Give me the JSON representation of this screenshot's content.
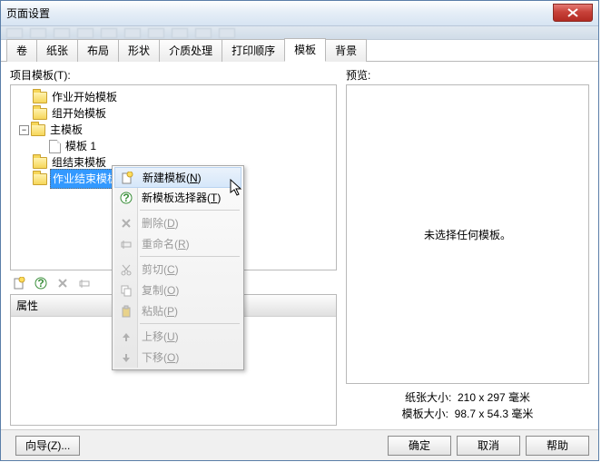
{
  "window": {
    "title": "页面设置"
  },
  "tabs": [
    "卷",
    "纸张",
    "布局",
    "形状",
    "介质处理",
    "打印顺序",
    "模板",
    "背景"
  ],
  "activeTabIndex": 6,
  "leftPane": {
    "label": "项目模板(T):",
    "tree": {
      "nodes": [
        {
          "label": "作业开始模板",
          "type": "folder"
        },
        {
          "label": "组开始模板",
          "type": "folder"
        },
        {
          "label": "主模板",
          "type": "folder",
          "expanded": true,
          "children": [
            {
              "label": "模板 1",
              "type": "doc"
            }
          ]
        },
        {
          "label": "组结束模板",
          "type": "folder"
        },
        {
          "label": "作业结束模板",
          "type": "folder",
          "selected": true
        }
      ]
    },
    "propHeader": "属性"
  },
  "contextMenu": {
    "items": [
      {
        "label": "新建模板",
        "mnemonic": "N",
        "enabled": true,
        "selected": true,
        "icon": "new-doc"
      },
      {
        "label": "新模板选择器",
        "mnemonic": "T",
        "enabled": true,
        "icon": "help"
      },
      {
        "sep": true
      },
      {
        "label": "删除",
        "mnemonic": "D",
        "enabled": false,
        "icon": "delete"
      },
      {
        "label": "重命名",
        "mnemonic": "R",
        "enabled": false,
        "icon": "rename"
      },
      {
        "sep": true
      },
      {
        "label": "剪切",
        "mnemonic": "C",
        "enabled": false,
        "icon": "cut"
      },
      {
        "label": "复制",
        "mnemonic": "O",
        "enabled": false,
        "icon": "copy"
      },
      {
        "label": "粘贴",
        "mnemonic": "P",
        "enabled": false,
        "icon": "paste"
      },
      {
        "sep": true
      },
      {
        "label": "上移",
        "mnemonic": "U",
        "enabled": false,
        "icon": "up"
      },
      {
        "label": "下移",
        "mnemonic": "O",
        "enabled": false,
        "icon": "down"
      }
    ]
  },
  "rightPane": {
    "label": "预览:",
    "placeholder": "未选择任何模板。",
    "paperSizeLabel": "纸张大小:",
    "paperSize": "210 x 297 毫米",
    "templateSizeLabel": "模板大小:",
    "templateSize": "98.7 x 54.3 毫米"
  },
  "footer": {
    "wizard": "向导(Z)...",
    "ok": "确定",
    "cancel": "取消",
    "help": "帮助"
  }
}
